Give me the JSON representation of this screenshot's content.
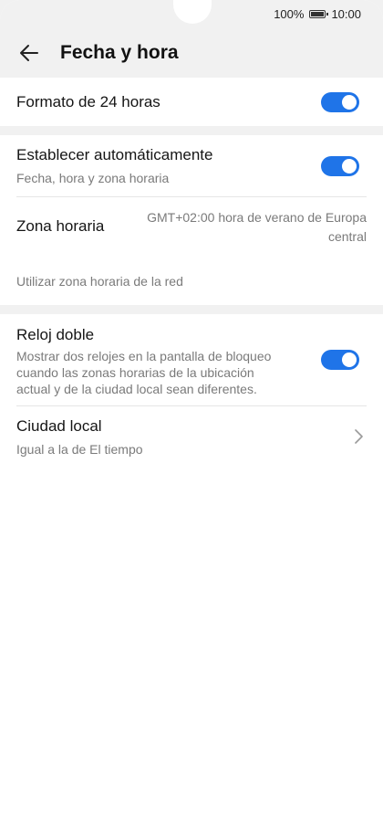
{
  "status": {
    "battery_percent": "100%",
    "time": "10:00"
  },
  "header": {
    "title": "Fecha y hora"
  },
  "format24": {
    "label": "Formato de 24 horas",
    "enabled": true
  },
  "auto": {
    "label": "Establecer automáticamente",
    "subtitle": "Fecha, hora y zona horaria",
    "enabled": true
  },
  "timezone": {
    "label": "Zona horaria",
    "value_line1": "GMT+02:00 hora de verano de Europa",
    "value_line2": "central",
    "network_label": "Utilizar zona horaria de la red"
  },
  "dual_clock": {
    "label": "Reloj doble",
    "description_line1": "Mostrar dos relojes en la pantalla de bloqueo",
    "description_line2": "cuando las zonas horarias de la ubicación",
    "description_line3": "actual y de la ciudad local sean diferentes.",
    "enabled": true
  },
  "home_city": {
    "label": "Ciudad local",
    "value": "Igual a la de El tiempo"
  },
  "colors": {
    "accent": "#1f74e8",
    "background": "#f1f1f1"
  }
}
